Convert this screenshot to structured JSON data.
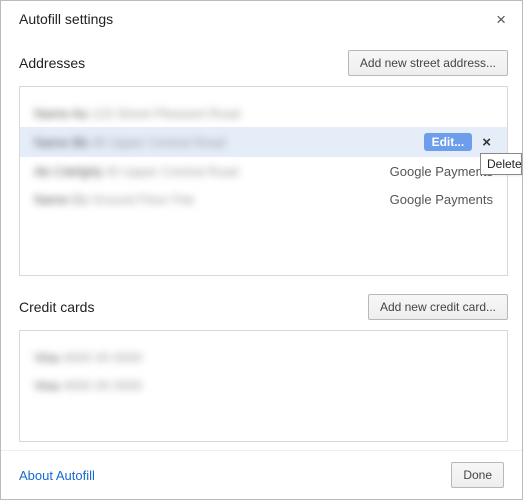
{
  "dialog": {
    "title": "Autofill settings",
    "close_label": "×"
  },
  "addresses": {
    "heading": "Addresses",
    "add_button": "Add new street address...",
    "rows": [
      {
        "text_strong": "Name Aa",
        "text_rest": "123 Street Pleasant Road",
        "source": ""
      },
      {
        "text_strong": "Name Bb",
        "text_rest": "45 Upper Central Road",
        "source": "",
        "selected": true,
        "edit_label": "Edit...",
        "delete_label": "×"
      },
      {
        "text_strong": "Ab Cdefghij",
        "text_rest": "45 Upper Central Road",
        "source": "Google Payments"
      },
      {
        "text_strong": "Name Cc",
        "text_rest": "Ground Floor Flat",
        "source": "Google Payments"
      }
    ]
  },
  "cards": {
    "heading": "Credit cards",
    "add_button": "Add new credit card...",
    "rows": [
      {
        "text_strong": "Visa",
        "text_rest": "4000 00 0000"
      },
      {
        "text_strong": "Visa",
        "text_rest": "4000 00 0000"
      }
    ]
  },
  "footer": {
    "about_link": "About Autofill",
    "done_button": "Done"
  },
  "tooltip": {
    "text": "Delete t"
  }
}
